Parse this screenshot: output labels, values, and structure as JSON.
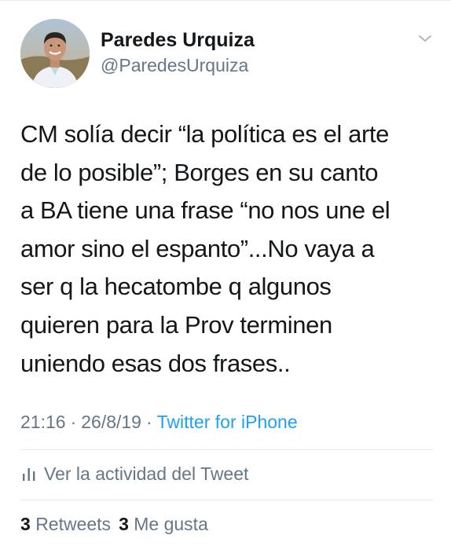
{
  "tweet": {
    "author": {
      "display_name": "Paredes Urquiza",
      "handle": "@ParedesUrquiza"
    },
    "text": "CM solía decir “la política es el arte\nde lo posible”; Borges en su canto\na BA tiene una frase “no nos une el\namor sino el espanto”...No vaya a\nser q la hecatombe q algunos\nquieren para la Prov terminen\nuniendo esas dos frases..",
    "time": "21:16",
    "separator": "·",
    "date": "26/8/19",
    "source": "Twitter for iPhone",
    "activity_label": "Ver la actividad del Tweet",
    "retweets_count": "3",
    "retweets_label": "Retweets",
    "likes_count": "3",
    "likes_label": "Me gusta"
  },
  "icons": {
    "caret": "chevron-down-icon",
    "activity": "bar-chart-icon",
    "avatar": "profile-photo"
  },
  "colors": {
    "text": "#14171a",
    "secondary": "#657786",
    "link": "#1da1f2",
    "divider": "#e6ecf0"
  }
}
